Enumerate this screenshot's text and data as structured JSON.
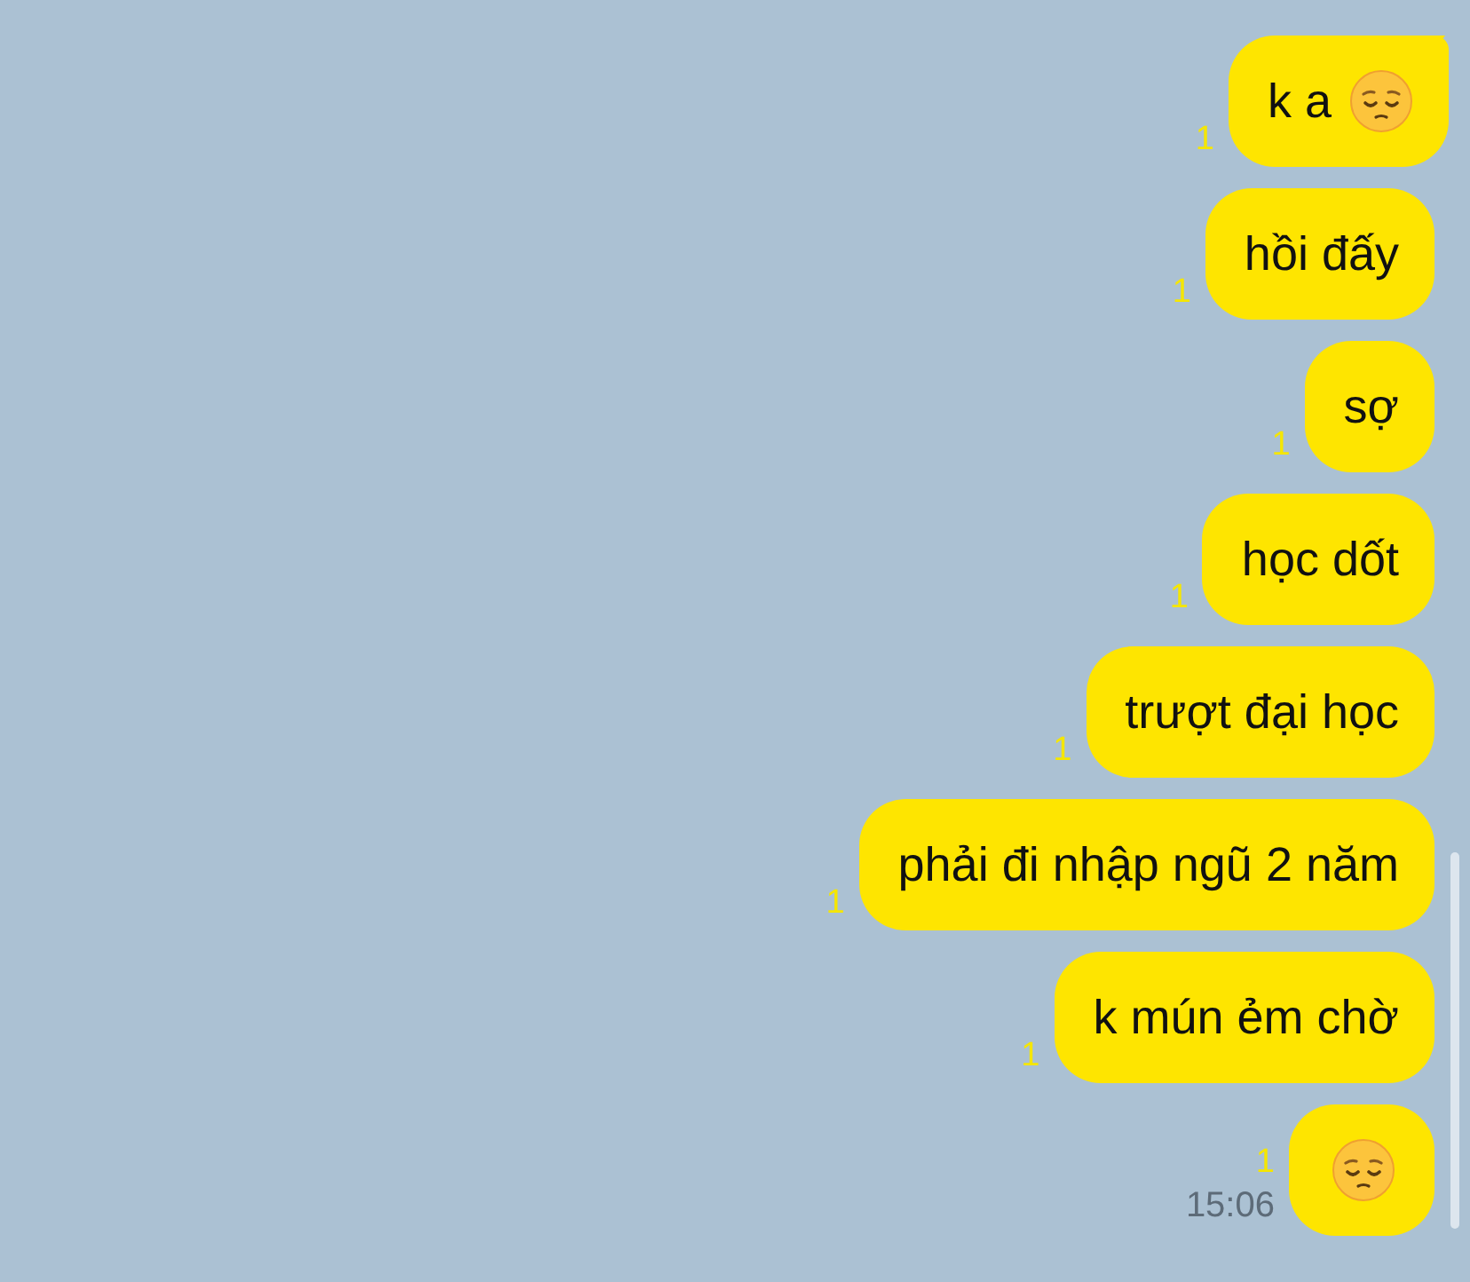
{
  "messages": [
    {
      "kind": "text_emoji",
      "text": "k a",
      "tail": true,
      "unread": "1"
    },
    {
      "kind": "text",
      "text": "hồi đấy",
      "tail": false,
      "unread": "1"
    },
    {
      "kind": "text",
      "text": "sợ",
      "tail": false,
      "unread": "1"
    },
    {
      "kind": "text",
      "text": "học dốt",
      "tail": false,
      "unread": "1"
    },
    {
      "kind": "text",
      "text": "trượt đại học",
      "tail": false,
      "unread": "1"
    },
    {
      "kind": "text",
      "text": "phải đi nhập ngũ 2 năm",
      "tail": false,
      "unread": "1"
    },
    {
      "kind": "text",
      "text": "k mún ẻm chờ",
      "tail": false,
      "unread": "1"
    },
    {
      "kind": "emoji",
      "tail": false,
      "unread": "1",
      "time": "15:06"
    }
  ]
}
